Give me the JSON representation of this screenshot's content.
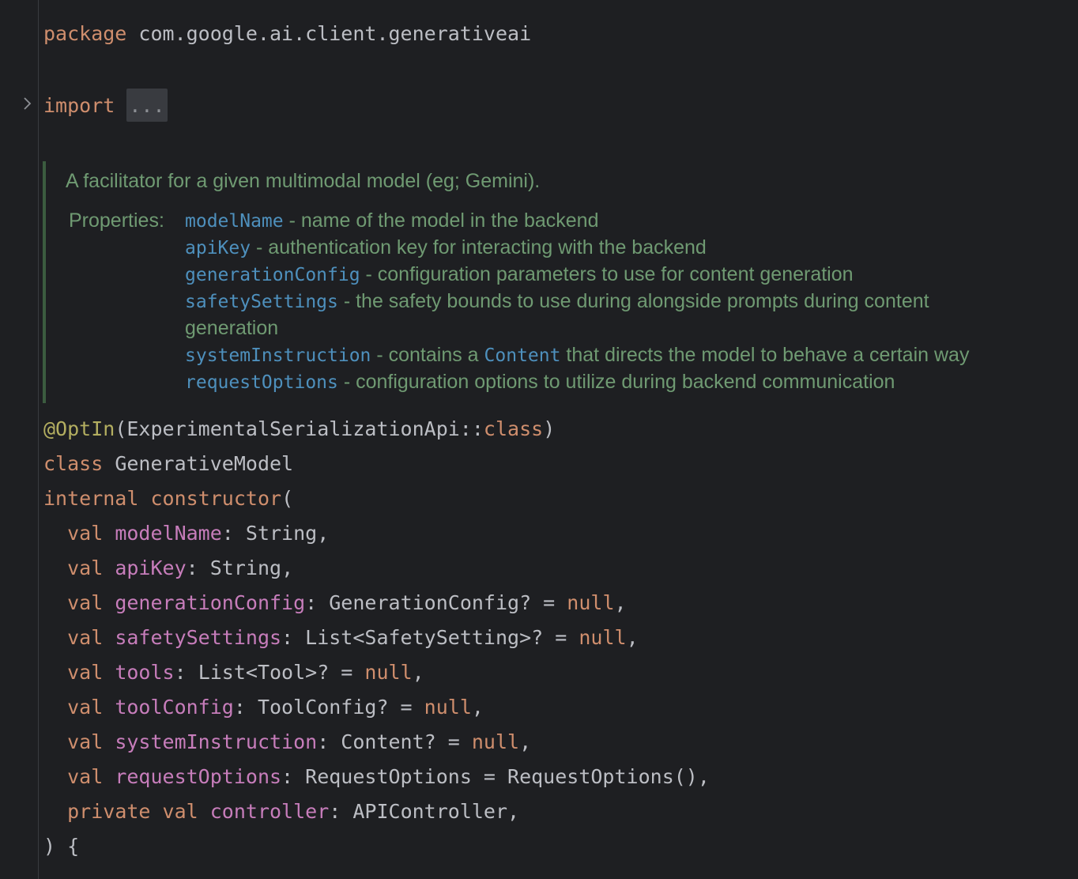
{
  "package_line": {
    "keyword": "package",
    "name": "com.google.ai.client.generativeai"
  },
  "import_line": {
    "keyword": "import",
    "folded": "..."
  },
  "doc": {
    "summary": "A facilitator for a given multimodal model (eg; Gemini).",
    "properties_label": "Properties:",
    "properties": [
      {
        "name": "modelName",
        "desc": " - name of the model in the backend"
      },
      {
        "name": "apiKey",
        "desc": " - authentication key for interacting with the backend"
      },
      {
        "name": "generationConfig",
        "desc": " - configuration parameters to use for content generation"
      },
      {
        "name": "safetySettings",
        "desc": " - the safety bounds to use during alongside prompts during content"
      },
      {
        "name": "",
        "desc": "generation"
      },
      {
        "name": "systemInstruction",
        "desc": " - contains a ",
        "link": "Content",
        "desc2": " that directs the model to behave a certain way"
      },
      {
        "name": "requestOptions",
        "desc": " - configuration options to utilize during backend communication"
      }
    ]
  },
  "annotation": {
    "name": "@OptIn",
    "open": "(",
    "arg": "ExperimentalSerializationApi::",
    "kw": "class",
    "close": ")"
  },
  "class_line": {
    "keyword": "class",
    "name": "GenerativeModel"
  },
  "ctor_line": {
    "kw1": "internal",
    "kw2": "constructor",
    "paren": "("
  },
  "params": [
    {
      "mod": "val",
      "name": "modelName",
      "type": ": String",
      "default": "",
      "trail": ","
    },
    {
      "mod": "val",
      "name": "apiKey",
      "type": ": String",
      "default": "",
      "trail": ","
    },
    {
      "mod": "val",
      "name": "generationConfig",
      "type": ": GenerationConfig? = ",
      "default": "null",
      "trail": ","
    },
    {
      "mod": "val",
      "name": "safetySettings",
      "type": ": List<SafetySetting>? = ",
      "default": "null",
      "trail": ","
    },
    {
      "mod": "val",
      "name": "tools",
      "type": ": List<Tool>? = ",
      "default": "null",
      "trail": ","
    },
    {
      "mod": "val",
      "name": "toolConfig",
      "type": ": ToolConfig? = ",
      "default": "null",
      "trail": ","
    },
    {
      "mod": "val",
      "name": "systemInstruction",
      "type": ": Content? = ",
      "default": "null",
      "trail": ","
    },
    {
      "mod": "val",
      "name": "requestOptions",
      "type": ": RequestOptions = RequestOptions()",
      "default": "",
      "trail": ","
    },
    {
      "mod": "private val",
      "name": "controller",
      "type": ": APIController",
      "default": "",
      "trail": ","
    }
  ],
  "closing_line": ") {",
  "colors": {
    "background": "#1e1f22",
    "keyword": "#cf8e6d",
    "annotation": "#b3ae60",
    "property": "#c77dbb",
    "doc_text": "#6f9a72",
    "doc_code": "#4e90bd",
    "plain": "#bcbec4"
  }
}
